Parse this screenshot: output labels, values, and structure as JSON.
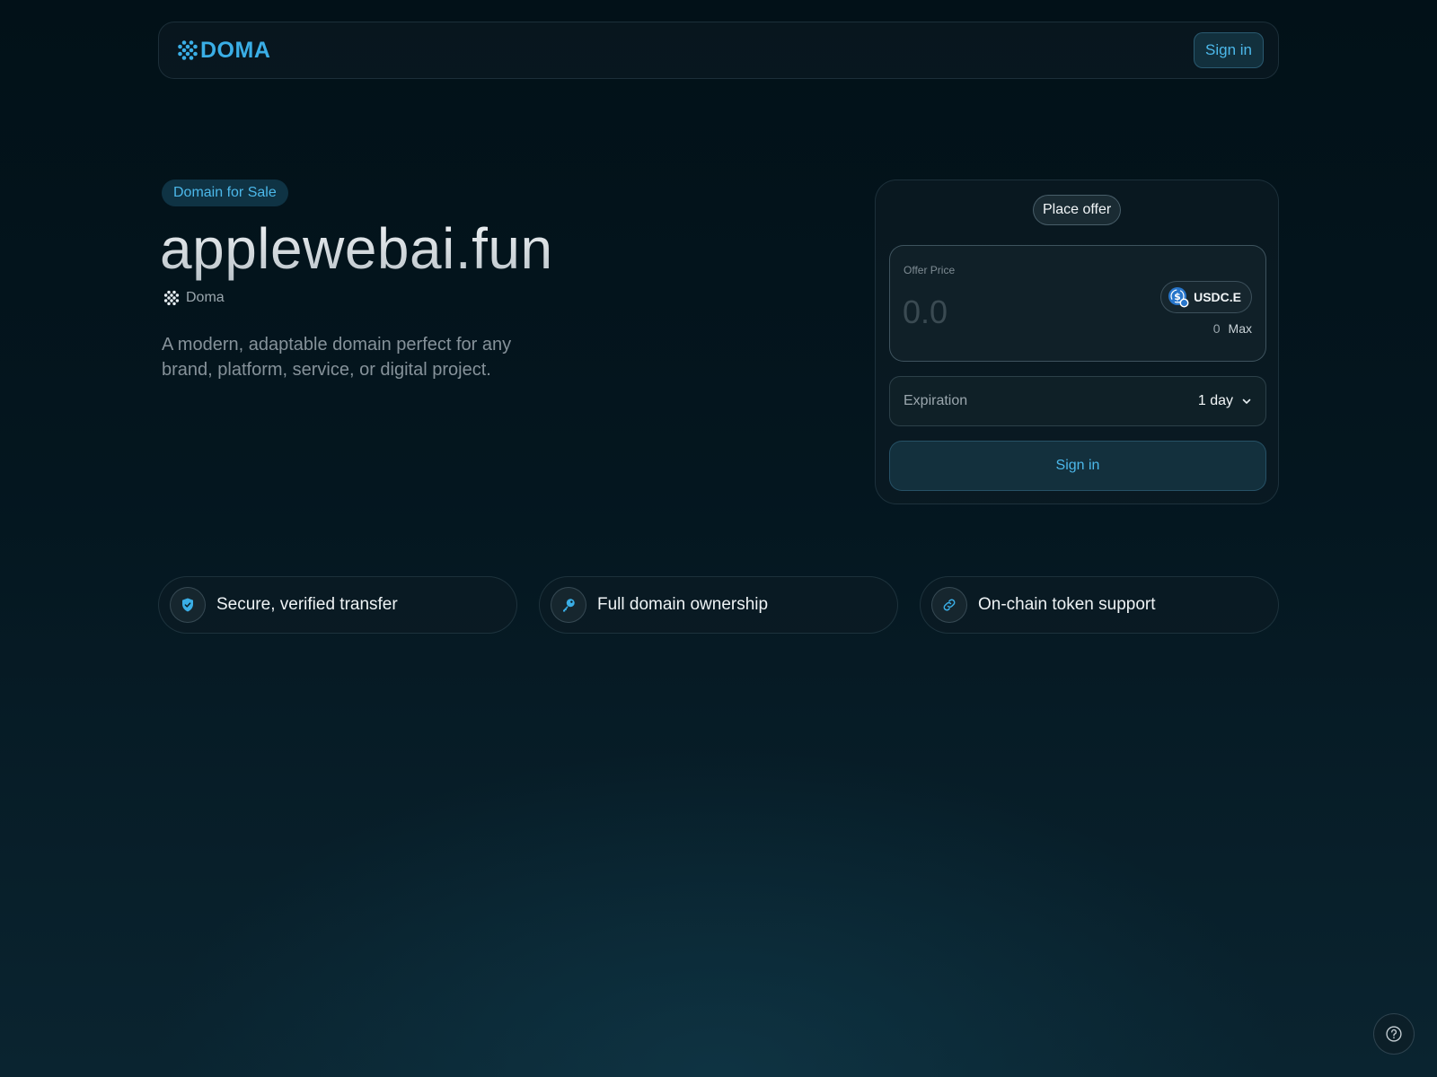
{
  "header": {
    "logo_text": "DOMA",
    "sign_in_label": "Sign in"
  },
  "hero": {
    "badge": "Domain for Sale",
    "domain": "applewebai.fun",
    "registrar": "Doma",
    "description": "A modern, adaptable domain perfect for any brand, platform, service, or digital project."
  },
  "offer": {
    "tab_label": "Place offer",
    "price_label": "Offer Price",
    "price_placeholder": "0.0",
    "token": "USDC.E",
    "balance": "0",
    "max_label": "Max",
    "expiration_label": "Expiration",
    "expiration_value": "1 day",
    "sign_in_label": "Sign in"
  },
  "features": [
    {
      "label": "Secure, verified transfer",
      "icon": "shield-check-icon"
    },
    {
      "label": "Full domain ownership",
      "icon": "key-icon"
    },
    {
      "label": "On-chain token support",
      "icon": "link-icon"
    }
  ],
  "colors": {
    "accent": "#3aaee6",
    "background": "#021118"
  }
}
